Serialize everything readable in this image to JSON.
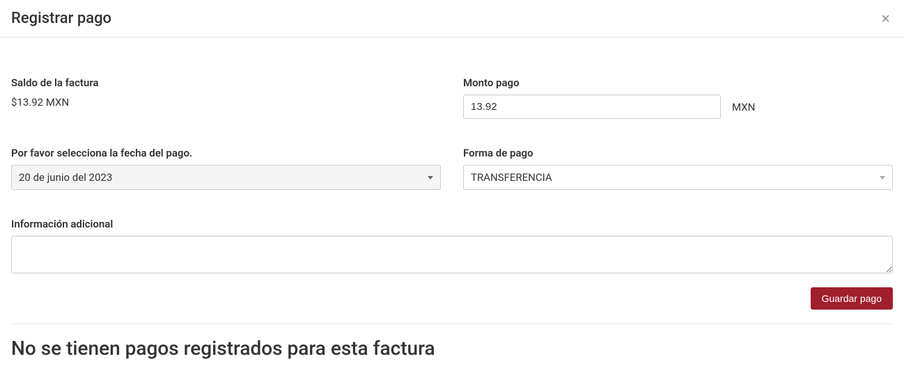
{
  "header": {
    "title": "Registrar pago"
  },
  "form": {
    "balance_label": "Saldo de la factura",
    "balance_value": "$13.92 MXN",
    "amount_label": "Monto pago",
    "amount_value": "13.92",
    "amount_currency": "MXN",
    "date_label": "Por favor selecciona la fecha del pago.",
    "date_value": "20 de junio del  2023",
    "method_label": "Forma de pago",
    "method_value": "TRANSFERENCIA",
    "additional_label": "Información adicional",
    "additional_value": "",
    "save_button": "Guardar pago"
  },
  "empty_state": "No se tienen pagos registrados para esta factura"
}
